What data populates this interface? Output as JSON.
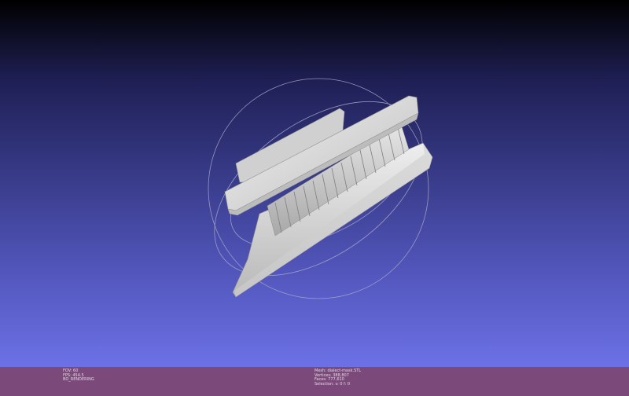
{
  "status_left": {
    "fov": "FOV: 60",
    "fps": "FPS: 454.5",
    "mode": "BO_RENDERING"
  },
  "status_right": {
    "mesh": "Mesh: dialect-mask.STL",
    "vertices": "Vertices: 388,807",
    "faces": "Faces: 777,610",
    "selection": "Selection: v: 0 f: 0"
  },
  "colors": {
    "statusbar": "#7b4a7b",
    "bg_top": "#000000",
    "bg_bottom": "#6c71e6",
    "model": "#d9d9d9"
  }
}
